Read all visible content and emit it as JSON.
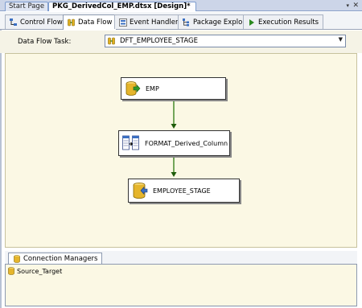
{
  "doc_tabs": [
    {
      "label": "Start Page",
      "active": false
    },
    {
      "label": "PKG_DerivedCol_EMP.dtsx [Design]*",
      "active": true
    }
  ],
  "window_buttons": {
    "dropdown": "▾",
    "close": "✕"
  },
  "designer_tabs": [
    {
      "label": "Control Flow",
      "icon": "control-flow-icon"
    },
    {
      "label": "Data Flow",
      "icon": "data-flow-icon",
      "active": true
    },
    {
      "label": "Event Handlers",
      "icon": "event-handlers-icon"
    },
    {
      "label": "Package Explorer",
      "icon": "package-explorer-icon"
    },
    {
      "label": "Execution Results",
      "icon": "execution-results-icon"
    }
  ],
  "task_bar": {
    "label": "Data Flow Task:",
    "selected_task": "DFT_EMPLOYEE_STAGE"
  },
  "components": [
    {
      "name": "EMP",
      "type": "source",
      "icon": "ole-db-source-icon"
    },
    {
      "name": "FORMAT_Derived_Column",
      "type": "transform",
      "icon": "derived-column-icon"
    },
    {
      "name": "EMPLOYEE_STAGE",
      "type": "destination",
      "icon": "ole-db-destination-icon"
    }
  ],
  "connection_managers": {
    "tab_label": "Connection Managers",
    "items": [
      "Source_Target"
    ]
  },
  "colors": {
    "canvas_bg": "#fbf8e4",
    "path_green": "#2a7a0e",
    "tab_bar_bg": "#ccd5e8"
  }
}
